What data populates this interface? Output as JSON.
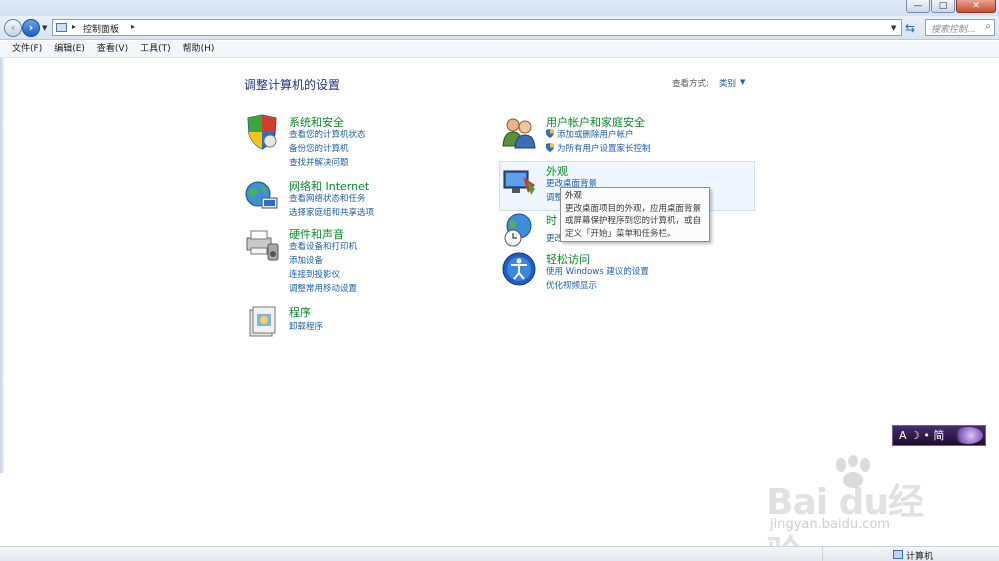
{
  "window": {
    "minimize": "—",
    "maximize": "□",
    "close": "✕"
  },
  "address": {
    "breadcrumb": "控制面板",
    "separator": "▸"
  },
  "search": {
    "placeholder": "搜索控制..."
  },
  "menu": {
    "items": [
      {
        "label": "文件(F)"
      },
      {
        "label": "编辑(E)"
      },
      {
        "label": "查看(V)"
      },
      {
        "label": "工具(T)"
      },
      {
        "label": "帮助(H)"
      }
    ]
  },
  "main": {
    "title": "调整计算机的设置",
    "view_by_label": "查看方式:",
    "view_by_value": "类别",
    "categories_left": [
      {
        "title": "系统和安全",
        "links": [
          "查看您的计算机状态",
          "备份您的计算机",
          "查找并解决问题"
        ]
      },
      {
        "title": "网络和 Internet",
        "links": [
          "查看网络状态和任务",
          "选择家庭组和共享选项"
        ]
      },
      {
        "title": "硬件和声音",
        "links": [
          "查看设备和打印机",
          "添加设备",
          "连接到投影仪",
          "调整常用移动设置"
        ]
      },
      {
        "title": "程序",
        "links": [
          "卸载程序"
        ]
      }
    ],
    "categories_right": [
      {
        "title": "用户帐户和家庭安全",
        "links": [
          "添加或删除用户帐户",
          "为所有用户设置家长控制"
        ]
      },
      {
        "title": "外观",
        "links": [
          "更改桌面背景",
          "调整"
        ]
      },
      {
        "title": "时",
        "links": [
          "更改"
        ]
      },
      {
        "title": "轻松访问",
        "links": [
          "使用 Windows 建议的设置",
          "优化视频显示"
        ]
      }
    ]
  },
  "tooltip": {
    "title": "外观",
    "line1": "更改桌面项目的外观，应用桌面背景",
    "line2": "或屏幕保护程序到您的计算机，或自",
    "line3": "定义「开始」菜单和任务栏。"
  },
  "ime": {
    "label": "A ☽ • 简"
  },
  "watermark": {
    "logo": "Bai  du经验",
    "url": "jingyan.baidu.com"
  },
  "status": {
    "text": "计算机"
  }
}
